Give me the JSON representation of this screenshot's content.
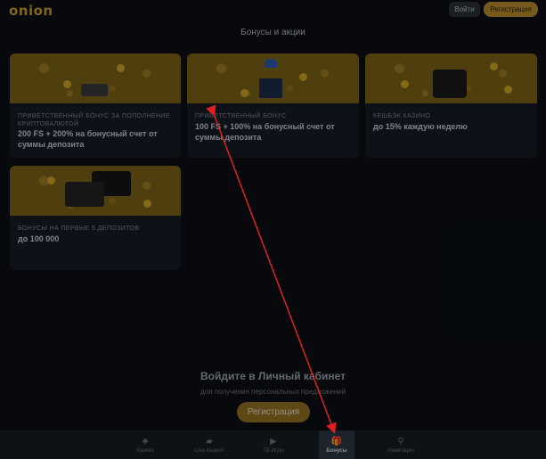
{
  "header": {
    "logo": "onion",
    "login_label": "Войти",
    "register_label": "Регистрация"
  },
  "page_title": "Бонусы и акции",
  "cards": [
    {
      "category": "ПРИВЕТСТВЕННЫЙ БОНУС ЗА ПОПОЛНЕНИЕ КРИПТОВАЛЮТОЙ",
      "title": "200 FS + 200% на бонусный счет от суммы депозита"
    },
    {
      "category": "ПРИВЕТСТВЕННЫЙ БОНУС",
      "title": "100 FS + 100% на бонусный счет от суммы депозита"
    },
    {
      "category": "КЕШБЭК КАЗИНО",
      "title": "до 15% каждую неделю"
    },
    {
      "category": "БОНУСЫ НА ПЕРВЫЕ 5 ДЕПОЗИТОВ",
      "title": "до 100 000"
    }
  ],
  "login_prompt": {
    "title": "Войдите в Личный кабинет",
    "subtitle": "для получения персональных предложений",
    "button": "Регистрация"
  },
  "bottom_nav": [
    {
      "label": "Казино",
      "icon": "slots-icon",
      "active": false
    },
    {
      "label": "Live Казино",
      "icon": "cards-icon",
      "active": false
    },
    {
      "label": "ТВ-Игры",
      "icon": "tv-icon",
      "active": false
    },
    {
      "label": "Бонусы",
      "icon": "gift-icon",
      "active": true
    },
    {
      "label": "Навигация",
      "icon": "search-list-icon",
      "active": false
    }
  ],
  "colors": {
    "accent": "#d9a826",
    "annotation_arrow": "#e02020"
  }
}
